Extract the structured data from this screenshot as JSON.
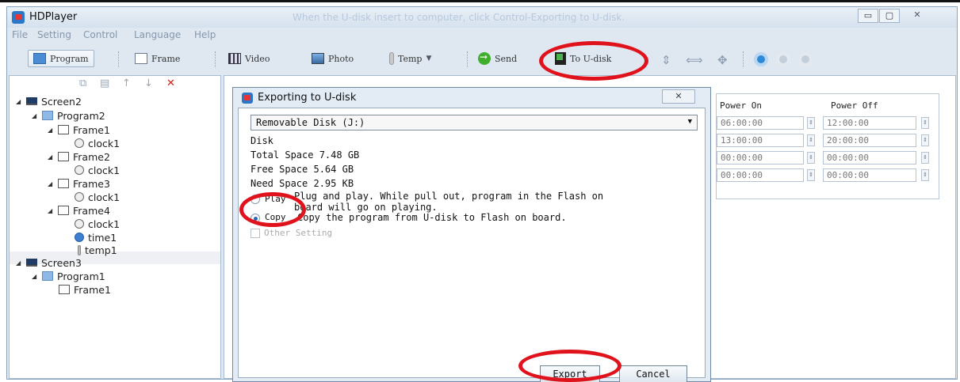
{
  "window": {
    "title": "HDPlayer",
    "faint_hint": "When the U-disk insert to computer, click Control-Exporting to U-disk.",
    "controls": {
      "minimize": "▭",
      "maximize": "▢",
      "close": "✕"
    }
  },
  "menu": [
    "File",
    "Setting",
    "Control",
    "Language",
    "Help"
  ],
  "toolbar": {
    "program": "Program",
    "frame": "Frame",
    "video": "Video",
    "photo": "Photo",
    "temp": "Temp",
    "send": "Send",
    "to_udisk": "To U-disk"
  },
  "tree": {
    "nodes": [
      {
        "label": "Screen2",
        "icon": "screen"
      },
      {
        "label": "Program2",
        "icon": "program"
      },
      {
        "label": "Frame1",
        "icon": "frame"
      },
      {
        "label": "clock1",
        "icon": "clock"
      },
      {
        "label": "Frame2",
        "icon": "frame"
      },
      {
        "label": "clock1",
        "icon": "clock"
      },
      {
        "label": "Frame3",
        "icon": "frame"
      },
      {
        "label": "clock1",
        "icon": "clock"
      },
      {
        "label": "Frame4",
        "icon": "frame"
      },
      {
        "label": "clock1",
        "icon": "clock"
      },
      {
        "label": "time1",
        "icon": "time"
      },
      {
        "label": "temp1",
        "icon": "temp"
      },
      {
        "label": "Screen3",
        "icon": "screen"
      },
      {
        "label": "Program1",
        "icon": "program"
      },
      {
        "label": "Frame1",
        "icon": "frame"
      }
    ]
  },
  "schedule": {
    "power_on_header": "Power On",
    "power_off_header": "Power Off",
    "rows": [
      {
        "on": "06:00:00",
        "off": "12:00:00"
      },
      {
        "on": "13:00:00",
        "off": "20:00:00"
      },
      {
        "on": "00:00:00",
        "off": "00:00:00"
      },
      {
        "on": "00:00:00",
        "off": "00:00:00"
      }
    ]
  },
  "dialog": {
    "title": "Exporting to U-disk",
    "close": "✕",
    "drive": "Removable Disk (J:)",
    "disk_label": "Disk",
    "total_space": "Total Space 7.48 GB",
    "free_space": "Free Space  5.64 GB",
    "need_space": "Need Space  2.95 KB",
    "play_label": "Play",
    "play_desc_line1": "Plug and play. While pull out, program in the Flash on",
    "play_desc_line2": "board will go on playing.",
    "copy_label": "Copy",
    "copy_desc": "Copy the program from U-disk to Flash on board.",
    "other_setting": "Other Setting",
    "export": "Export",
    "cancel": "Cancel"
  },
  "colors": {
    "highlight": "#e0121b",
    "window_bg": "#dfe8f1",
    "accent": "#2b78c8"
  }
}
